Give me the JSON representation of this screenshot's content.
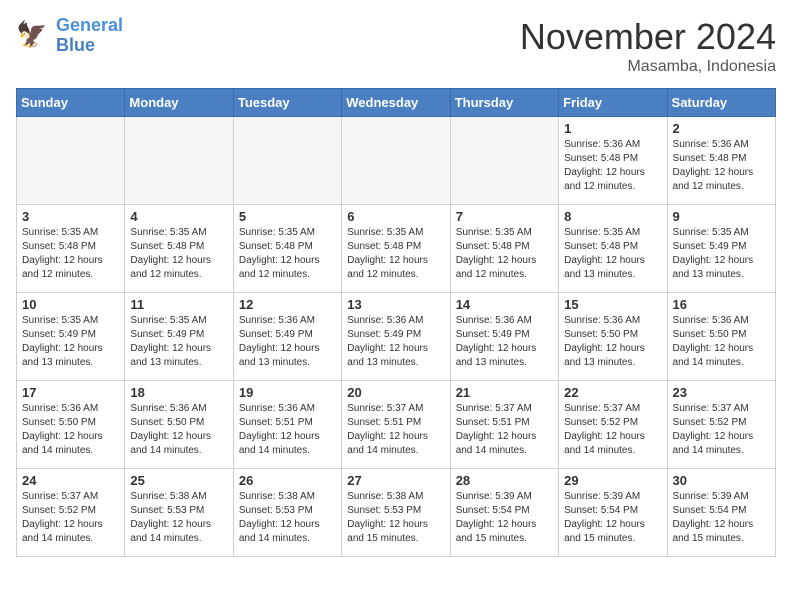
{
  "header": {
    "logo_line1": "General",
    "logo_line2": "Blue",
    "month": "November 2024",
    "location": "Masamba, Indonesia"
  },
  "weekdays": [
    "Sunday",
    "Monday",
    "Tuesday",
    "Wednesday",
    "Thursday",
    "Friday",
    "Saturday"
  ],
  "weeks": [
    [
      {
        "day": "",
        "info": ""
      },
      {
        "day": "",
        "info": ""
      },
      {
        "day": "",
        "info": ""
      },
      {
        "day": "",
        "info": ""
      },
      {
        "day": "",
        "info": ""
      },
      {
        "day": "1",
        "info": "Sunrise: 5:36 AM\nSunset: 5:48 PM\nDaylight: 12 hours\nand 12 minutes."
      },
      {
        "day": "2",
        "info": "Sunrise: 5:36 AM\nSunset: 5:48 PM\nDaylight: 12 hours\nand 12 minutes."
      }
    ],
    [
      {
        "day": "3",
        "info": "Sunrise: 5:35 AM\nSunset: 5:48 PM\nDaylight: 12 hours\nand 12 minutes."
      },
      {
        "day": "4",
        "info": "Sunrise: 5:35 AM\nSunset: 5:48 PM\nDaylight: 12 hours\nand 12 minutes."
      },
      {
        "day": "5",
        "info": "Sunrise: 5:35 AM\nSunset: 5:48 PM\nDaylight: 12 hours\nand 12 minutes."
      },
      {
        "day": "6",
        "info": "Sunrise: 5:35 AM\nSunset: 5:48 PM\nDaylight: 12 hours\nand 12 minutes."
      },
      {
        "day": "7",
        "info": "Sunrise: 5:35 AM\nSunset: 5:48 PM\nDaylight: 12 hours\nand 12 minutes."
      },
      {
        "day": "8",
        "info": "Sunrise: 5:35 AM\nSunset: 5:48 PM\nDaylight: 12 hours\nand 13 minutes."
      },
      {
        "day": "9",
        "info": "Sunrise: 5:35 AM\nSunset: 5:49 PM\nDaylight: 12 hours\nand 13 minutes."
      }
    ],
    [
      {
        "day": "10",
        "info": "Sunrise: 5:35 AM\nSunset: 5:49 PM\nDaylight: 12 hours\nand 13 minutes."
      },
      {
        "day": "11",
        "info": "Sunrise: 5:35 AM\nSunset: 5:49 PM\nDaylight: 12 hours\nand 13 minutes."
      },
      {
        "day": "12",
        "info": "Sunrise: 5:36 AM\nSunset: 5:49 PM\nDaylight: 12 hours\nand 13 minutes."
      },
      {
        "day": "13",
        "info": "Sunrise: 5:36 AM\nSunset: 5:49 PM\nDaylight: 12 hours\nand 13 minutes."
      },
      {
        "day": "14",
        "info": "Sunrise: 5:36 AM\nSunset: 5:49 PM\nDaylight: 12 hours\nand 13 minutes."
      },
      {
        "day": "15",
        "info": "Sunrise: 5:36 AM\nSunset: 5:50 PM\nDaylight: 12 hours\nand 13 minutes."
      },
      {
        "day": "16",
        "info": "Sunrise: 5:36 AM\nSunset: 5:50 PM\nDaylight: 12 hours\nand 14 minutes."
      }
    ],
    [
      {
        "day": "17",
        "info": "Sunrise: 5:36 AM\nSunset: 5:50 PM\nDaylight: 12 hours\nand 14 minutes."
      },
      {
        "day": "18",
        "info": "Sunrise: 5:36 AM\nSunset: 5:50 PM\nDaylight: 12 hours\nand 14 minutes."
      },
      {
        "day": "19",
        "info": "Sunrise: 5:36 AM\nSunset: 5:51 PM\nDaylight: 12 hours\nand 14 minutes."
      },
      {
        "day": "20",
        "info": "Sunrise: 5:37 AM\nSunset: 5:51 PM\nDaylight: 12 hours\nand 14 minutes."
      },
      {
        "day": "21",
        "info": "Sunrise: 5:37 AM\nSunset: 5:51 PM\nDaylight: 12 hours\nand 14 minutes."
      },
      {
        "day": "22",
        "info": "Sunrise: 5:37 AM\nSunset: 5:52 PM\nDaylight: 12 hours\nand 14 minutes."
      },
      {
        "day": "23",
        "info": "Sunrise: 5:37 AM\nSunset: 5:52 PM\nDaylight: 12 hours\nand 14 minutes."
      }
    ],
    [
      {
        "day": "24",
        "info": "Sunrise: 5:37 AM\nSunset: 5:52 PM\nDaylight: 12 hours\nand 14 minutes."
      },
      {
        "day": "25",
        "info": "Sunrise: 5:38 AM\nSunset: 5:53 PM\nDaylight: 12 hours\nand 14 minutes."
      },
      {
        "day": "26",
        "info": "Sunrise: 5:38 AM\nSunset: 5:53 PM\nDaylight: 12 hours\nand 14 minutes."
      },
      {
        "day": "27",
        "info": "Sunrise: 5:38 AM\nSunset: 5:53 PM\nDaylight: 12 hours\nand 15 minutes."
      },
      {
        "day": "28",
        "info": "Sunrise: 5:39 AM\nSunset: 5:54 PM\nDaylight: 12 hours\nand 15 minutes."
      },
      {
        "day": "29",
        "info": "Sunrise: 5:39 AM\nSunset: 5:54 PM\nDaylight: 12 hours\nand 15 minutes."
      },
      {
        "day": "30",
        "info": "Sunrise: 5:39 AM\nSunset: 5:54 PM\nDaylight: 12 hours\nand 15 minutes."
      }
    ]
  ]
}
